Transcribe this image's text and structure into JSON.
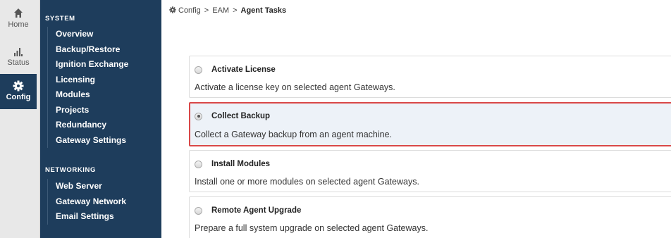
{
  "rail": {
    "items": [
      {
        "label": "Home",
        "icon": "home-icon"
      },
      {
        "label": "Status",
        "icon": "bar-chart-icon"
      },
      {
        "label": "Config",
        "icon": "gear-icon"
      }
    ],
    "active_color": "#1e3d5c"
  },
  "nav": {
    "sections": [
      {
        "title": "SYSTEM",
        "items": [
          "Overview",
          "Backup/Restore",
          "Ignition Exchange",
          "Licensing",
          "Modules",
          "Projects",
          "Redundancy",
          "Gateway Settings"
        ]
      },
      {
        "title": "NETWORKING",
        "items": [
          "Web Server",
          "Gateway Network",
          "Email Settings"
        ]
      }
    ],
    "background": "#1e3d5c"
  },
  "breadcrumb": {
    "items": [
      "Config",
      "EAM",
      "Agent Tasks"
    ],
    "separator": ">"
  },
  "tasks": [
    {
      "title": "Activate License",
      "description": "Activate a license key on selected agent Gateways.",
      "selected": false
    },
    {
      "title": "Collect Backup",
      "description": "Collect a Gateway backup from an agent machine.",
      "selected": true
    },
    {
      "title": "Install Modules",
      "description": "Install one or more modules on selected agent Gateways.",
      "selected": false
    },
    {
      "title": "Remote Agent Upgrade",
      "description": "Prepare a full system upgrade on selected agent Gateways.",
      "selected": false
    }
  ],
  "highlight_color": "#d94848"
}
